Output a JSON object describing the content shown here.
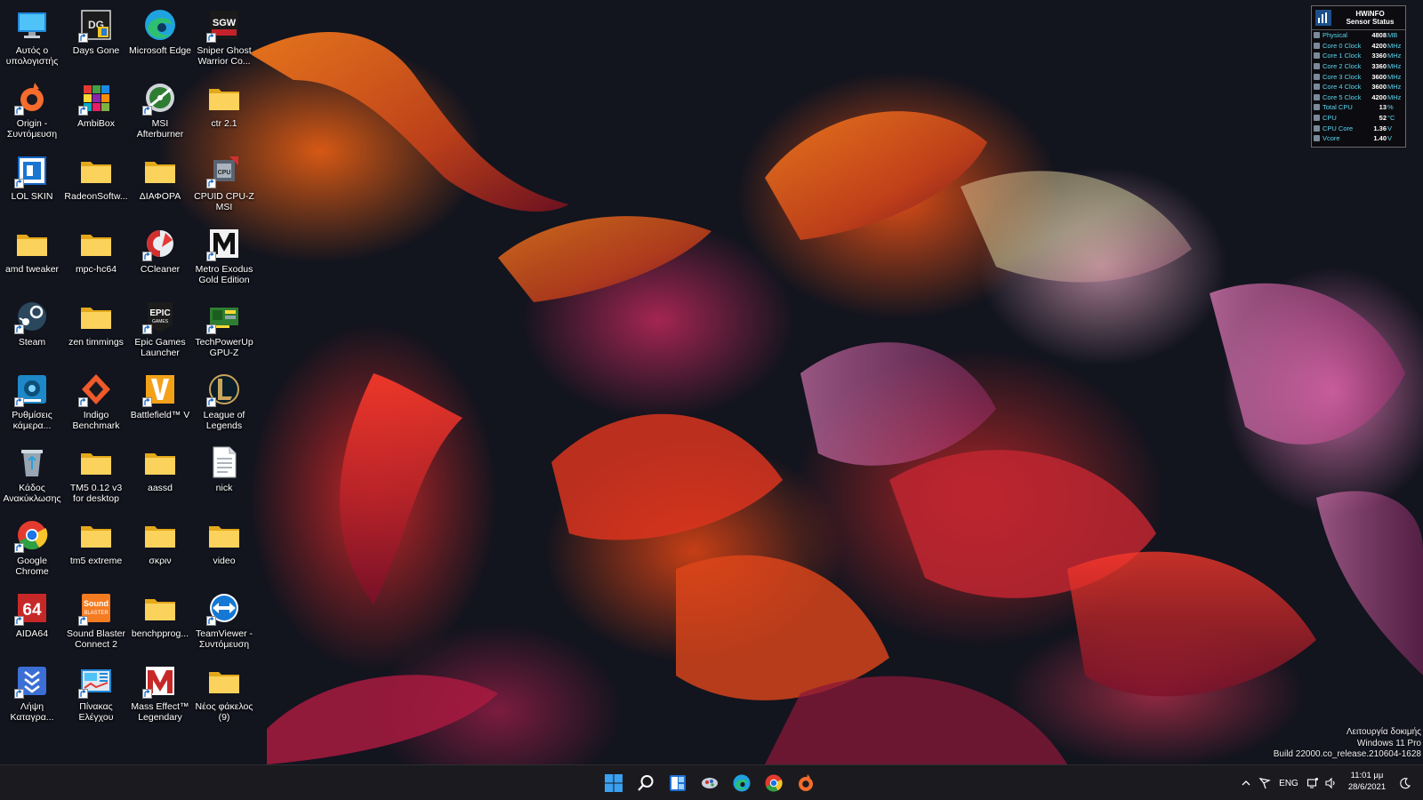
{
  "desktop": {
    "icons": [
      {
        "label": "Αυτός ο υπολογιστής",
        "icon": "computer-icon",
        "shortcut": false
      },
      {
        "label": "Days Gone",
        "icon": "days-gone-icon",
        "shortcut": true
      },
      {
        "label": "Microsoft Edge",
        "icon": "edge-icon",
        "shortcut": false
      },
      {
        "label": "Sniper Ghost Warrior Co...",
        "icon": "sniper-ghost-warrior-icon",
        "shortcut": true
      },
      {
        "label": "Origin - Συντόμευση",
        "icon": "origin-icon",
        "shortcut": true
      },
      {
        "label": "AmbiBox",
        "icon": "ambibox-icon",
        "shortcut": true
      },
      {
        "label": "MSI Afterburner",
        "icon": "msi-afterburner-icon",
        "shortcut": true
      },
      {
        "label": "ctr 2.1",
        "icon": "folder-icon",
        "shortcut": false
      },
      {
        "label": "LOL SKIN",
        "icon": "lol-skin-icon",
        "shortcut": true
      },
      {
        "label": "RadeonSoftw...",
        "icon": "folder-icon",
        "shortcut": false
      },
      {
        "label": "ΔΙΑΦΟΡΑ",
        "icon": "folder-icon",
        "shortcut": false
      },
      {
        "label": "CPUID CPU-Z MSI",
        "icon": "cpu-z-icon",
        "shortcut": true
      },
      {
        "label": "amd tweaker",
        "icon": "folder-icon",
        "shortcut": false
      },
      {
        "label": "mpc-hc64",
        "icon": "folder-icon",
        "shortcut": false
      },
      {
        "label": "CCleaner",
        "icon": "ccleaner-icon",
        "shortcut": true
      },
      {
        "label": "Metro Exodus Gold Edition",
        "icon": "metro-exodus-icon",
        "shortcut": true
      },
      {
        "label": "Steam",
        "icon": "steam-icon",
        "shortcut": true
      },
      {
        "label": "zen timmings",
        "icon": "folder-icon",
        "shortcut": false
      },
      {
        "label": "Epic Games Launcher",
        "icon": "epic-games-icon",
        "shortcut": true
      },
      {
        "label": "TechPowerUp GPU-Z",
        "icon": "gpu-z-icon",
        "shortcut": true
      },
      {
        "label": "Ρυθμίσεις κάμερα...",
        "icon": "camera-settings-icon",
        "shortcut": true
      },
      {
        "label": "Indigo Benchmark",
        "icon": "indigo-benchmark-icon",
        "shortcut": true
      },
      {
        "label": "Battlefield™ V",
        "icon": "battlefield-icon",
        "shortcut": true
      },
      {
        "label": "League of Legends",
        "icon": "league-of-legends-icon",
        "shortcut": true
      },
      {
        "label": "Κάδος Ανακύκλωσης",
        "icon": "recycle-bin-icon",
        "shortcut": false
      },
      {
        "label": "TM5 0.12 v3 for desktop",
        "icon": "folder-icon",
        "shortcut": false
      },
      {
        "label": "aassd",
        "icon": "folder-icon",
        "shortcut": false
      },
      {
        "label": "nick",
        "icon": "text-file-icon",
        "shortcut": false
      },
      {
        "label": "Google Chrome",
        "icon": "chrome-icon",
        "shortcut": true
      },
      {
        "label": "tm5 extreme",
        "icon": "folder-icon",
        "shortcut": false
      },
      {
        "label": "σκριν",
        "icon": "folder-icon",
        "shortcut": false
      },
      {
        "label": "video",
        "icon": "folder-icon",
        "shortcut": false
      },
      {
        "label": "AIDA64",
        "icon": "aida64-icon",
        "shortcut": true
      },
      {
        "label": "Sound Blaster Connect 2",
        "icon": "sound-blaster-icon",
        "shortcut": true
      },
      {
        "label": "benchpprog...",
        "icon": "folder-icon",
        "shortcut": false
      },
      {
        "label": "TeamViewer - Συντόμευση",
        "icon": "teamviewer-icon",
        "shortcut": true
      },
      {
        "label": "Λήψη Καταγρα...",
        "icon": "download-capture-icon",
        "shortcut": true
      },
      {
        "label": "Πίνακας Ελέγχου",
        "icon": "control-panel-icon",
        "shortcut": true
      },
      {
        "label": "Mass Effect™ Legendary Ed...",
        "icon": "mass-effect-icon",
        "shortcut": true
      },
      {
        "label": "Νέος φάκελος (9)",
        "icon": "folder-icon",
        "shortcut": false
      }
    ]
  },
  "hwinfo": {
    "title_line1": "HWiNFO",
    "title_line2": "Sensor Status",
    "rows": [
      {
        "name": "Physical",
        "value": "4808",
        "unit": "MB"
      },
      {
        "name": "Core 0 Clock",
        "value": "4200",
        "unit": "MHz"
      },
      {
        "name": "Core 1 Clock",
        "value": "3360",
        "unit": "MHz"
      },
      {
        "name": "Core 2 Clock",
        "value": "3360",
        "unit": "MHz"
      },
      {
        "name": "Core 3 Clock",
        "value": "3600",
        "unit": "MHz"
      },
      {
        "name": "Core 4 Clock",
        "value": "3600",
        "unit": "MHz"
      },
      {
        "name": "Core 5 Clock",
        "value": "4200",
        "unit": "MHz"
      },
      {
        "name": "Total CPU",
        "value": "13",
        "unit": "%"
      },
      {
        "name": "CPU",
        "value": "52",
        "unit": "°C"
      },
      {
        "name": "CPU Core",
        "value": "1.36",
        "unit": "V"
      },
      {
        "name": "Vcore",
        "value": "1.40",
        "unit": "V"
      }
    ]
  },
  "watermark": {
    "line1": "Λειτουργία δοκιμής",
    "line2": "Windows 11 Pro",
    "line3": "Build 22000.co_release.210604-1628"
  },
  "taskbar": {
    "apps": [
      "start-icon",
      "search-icon",
      "widgets-icon",
      "hwinfo-icon",
      "edge-icon",
      "chrome-icon",
      "origin-icon"
    ],
    "tray": {
      "language": "ENG",
      "time": "11:01 μμ",
      "date": "28/6/2021"
    }
  }
}
